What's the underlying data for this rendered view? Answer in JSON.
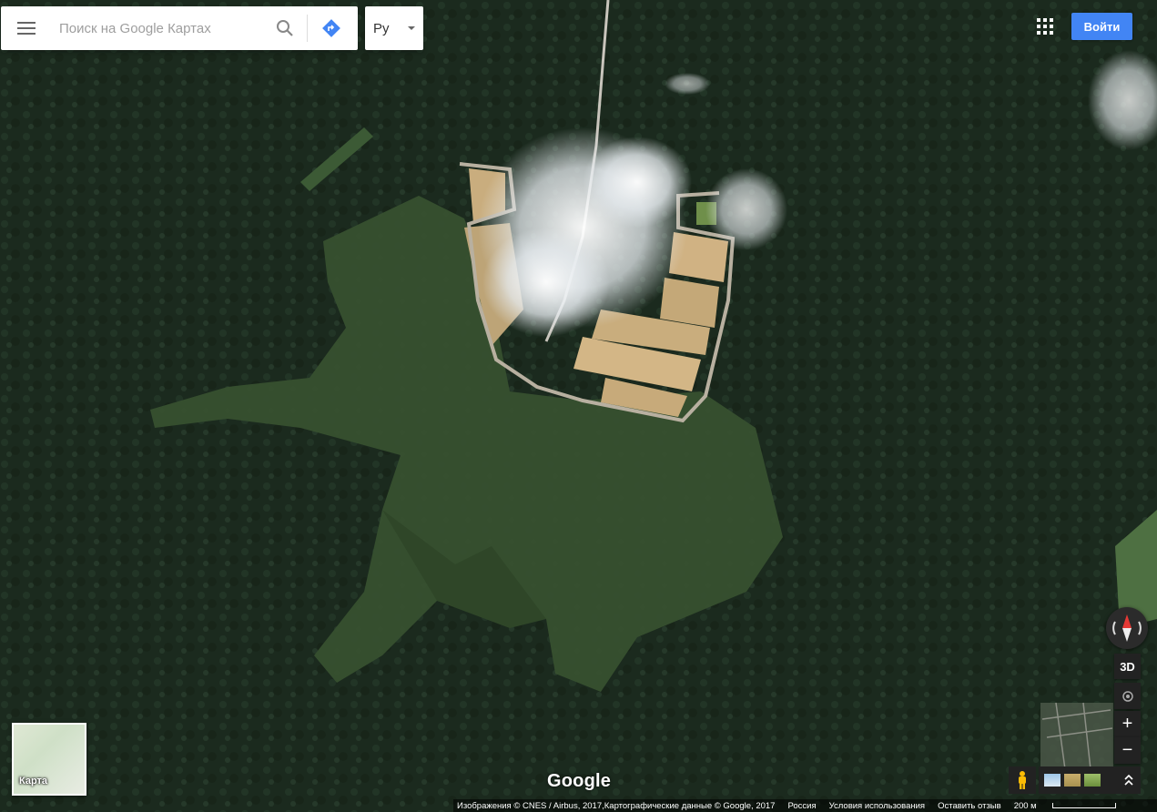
{
  "search": {
    "placeholder": "Поиск на Google Картах"
  },
  "language": {
    "label": "Ру"
  },
  "header": {
    "sign_in_label": "Войти"
  },
  "minimap": {
    "label": "Карта"
  },
  "brand": {
    "logo_text": "Google",
    "accent": "#4285f4"
  },
  "controls": {
    "three_d_label": "3D",
    "zoom_in_label": "+",
    "zoom_out_label": "−"
  },
  "footer": {
    "attribution": "Изображения © CNES / Airbus, 2017,Картографические данные © Google, 2017",
    "country": "Россия",
    "terms": "Условия использования",
    "feedback": "Оставить отзыв",
    "scale": "200 м"
  },
  "icons": [
    "menu-icon",
    "search-icon",
    "directions-icon",
    "chevron-down-icon",
    "apps-icon",
    "compass-icon",
    "my-location-icon",
    "pegman-icon",
    "layers-expand-icon"
  ]
}
